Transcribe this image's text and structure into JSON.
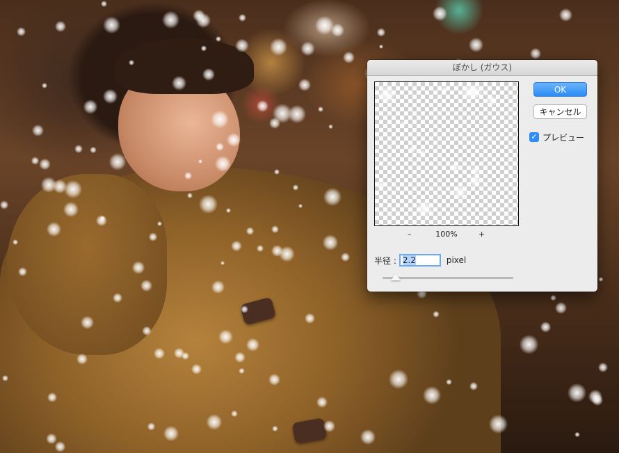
{
  "dialog": {
    "title": "ぼかし (ガウス)",
    "ok_label": "OK",
    "cancel_label": "キャンセル",
    "preview_label": "プレビュー",
    "preview_checked": true,
    "zoom_minus": "–",
    "zoom_level": "100%",
    "zoom_plus": "+",
    "radius_label": "半径 :",
    "radius_value": "2.2",
    "radius_unit": "pixel",
    "radius_slider_fraction": 0.1
  },
  "colors": {
    "ok_button": "#2a8cf6",
    "checkbox": "#2f8df5",
    "dialog_bg": "#ececec"
  }
}
